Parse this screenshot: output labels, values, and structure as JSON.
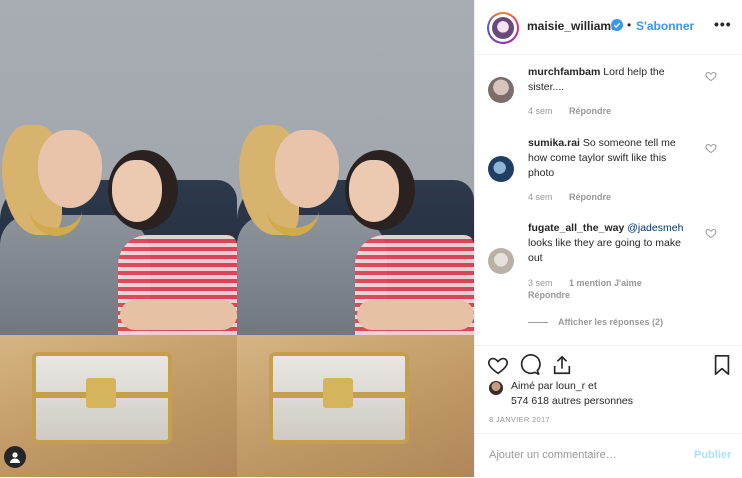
{
  "post": {
    "username": "maisie_williams",
    "separator": "•",
    "follow_label": "S'abonner",
    "more_label": "•••",
    "comments": [
      {
        "username": "murchfambam",
        "text": "Lord help the sister....",
        "age": "4 sem",
        "reply_label": "Répondre"
      },
      {
        "username": "sumika.rai",
        "text": "So someone tell me how come taylor swift like this photo",
        "age": "4 sem",
        "reply_label": "Répondre"
      },
      {
        "username": "fugate_all_the_way",
        "mention": "@jadesmeh",
        "text": "looks like they are going to make out",
        "age": "3 sem",
        "mentions_label": "1 mention J'aime",
        "reply_label": "Répondre"
      }
    ],
    "view_replies_label": "Afficher les réponses (2)",
    "likes_line1": "Aimé par loun_r et",
    "likes_line2": "574 618 autres personnes",
    "date": "8 JANVIER 2017",
    "comment_placeholder": "Ajouter un commentaire…",
    "publish_label": "Publier"
  },
  "colors": {
    "accent": "#3897f0",
    "verified": "#3897f0",
    "publish_disabled": "#b2dffc",
    "muted": "#999999"
  },
  "icons": [
    "profile-icon",
    "verified-badge-icon",
    "heart-icon",
    "comment-icon",
    "share-icon",
    "bookmark-icon",
    "more-icon"
  ]
}
